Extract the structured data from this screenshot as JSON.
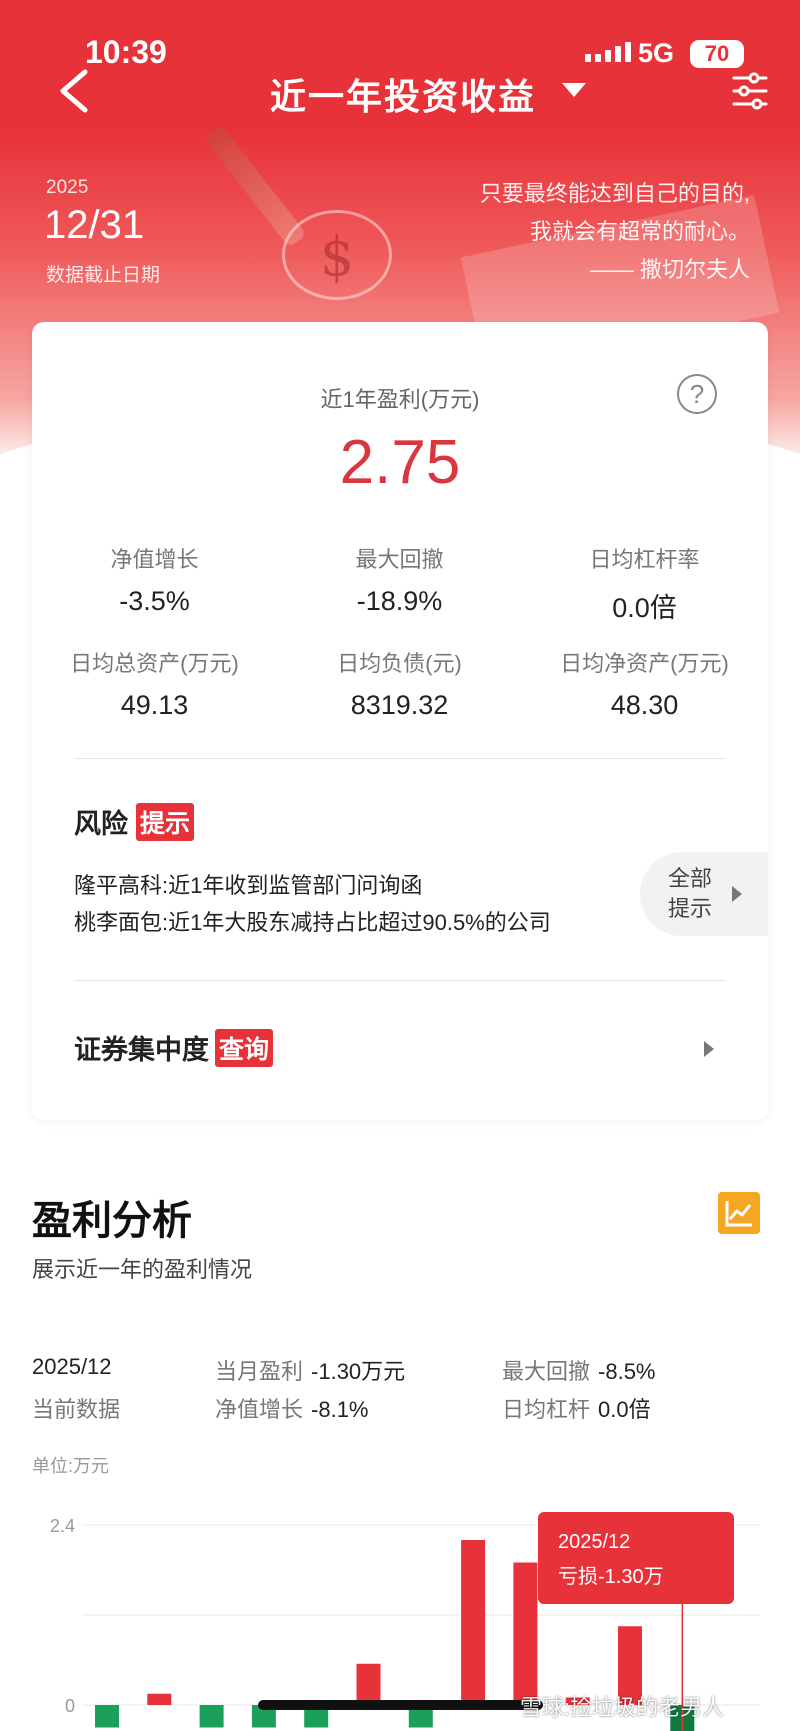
{
  "status": {
    "time": "10:39",
    "network": "5G",
    "battery": "70"
  },
  "nav": {
    "title": "近一年投资收益"
  },
  "hero": {
    "year": "2025",
    "month_day": "12/31",
    "date_label": "数据截止日期",
    "quote_line1": "只要最终能达到自己的目的,",
    "quote_line2": "我就会有超常的耐心。",
    "quote_author": "—— 撒切尔夫人"
  },
  "summary_card": {
    "profit_label": "近1年盈利(万元)",
    "profit_value": "2.75",
    "stats": [
      {
        "label": "净值增长",
        "value": "-3.5%"
      },
      {
        "label": "最大回撤",
        "value": "-18.9%"
      },
      {
        "label": "日均杠杆率",
        "value": "0.0倍"
      },
      {
        "label": "日均总资产(万元)",
        "value": "49.13"
      },
      {
        "label": "日均负债(元)",
        "value": "8319.32"
      },
      {
        "label": "日均净资产(万元)",
        "value": "48.30"
      }
    ]
  },
  "risk": {
    "title": "风险",
    "tag": "提示",
    "items": [
      {
        "name": "隆平高科:",
        "text": "近1年收到监管部门问询函"
      },
      {
        "name": "桃李面包:",
        "text": "近1年大股东减持占比超过90.5%的公司"
      }
    ],
    "all_line1": "全部",
    "all_line2": "提示"
  },
  "concentration": {
    "title": "证券集中度",
    "tag": "查询"
  },
  "analysis": {
    "title": "盈利分析",
    "subtitle": "展示近一年的盈利情况",
    "month": "2025/12",
    "current_label": "当前数据",
    "month_profit_label": "当月盈利",
    "month_profit_value": "-1.30万元",
    "drawdown_label": "最大回撤",
    "drawdown_value": "-8.5%",
    "nav_growth_label": "净值增长",
    "nav_growth_value": "-8.1%",
    "leverage_label": "日均杠杆",
    "leverage_value": "0.0倍",
    "unit": "单位:万元"
  },
  "chart_data": {
    "type": "bar",
    "ylabel": "",
    "ytick_labels": [
      "2.4",
      "0"
    ],
    "ylim": [
      -0.5,
      2.6
    ],
    "values": [
      -0.3,
      0.15,
      -0.3,
      -0.3,
      -0.3,
      0.55,
      -0.3,
      2.2,
      1.9,
      0.1,
      1.05,
      -1.3
    ],
    "colors": {
      "positive": "#e8323a",
      "negative": "#1aa05a",
      "highlight_negative": "#0f7a40"
    },
    "tooltip": {
      "date": "2025/12",
      "text": "亏损-1.30万"
    }
  },
  "watermark": "雪球:捡垃圾的老男人"
}
